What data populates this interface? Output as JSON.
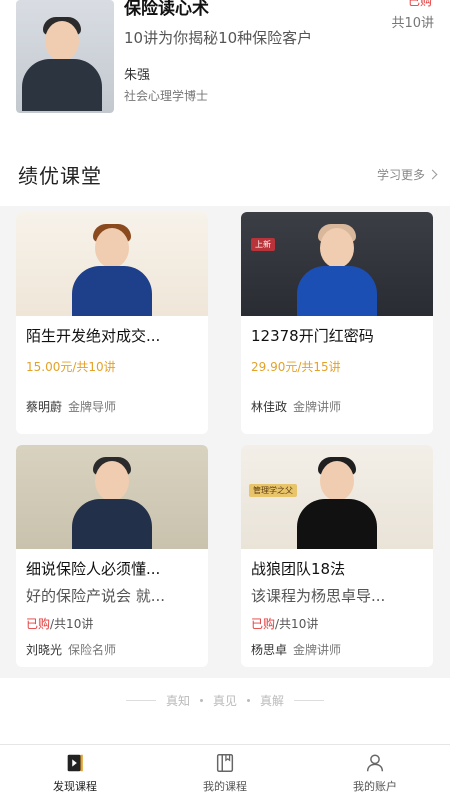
{
  "top_course": {
    "title": "保险读心术",
    "subtitle": "10讲为你揭秘10种保险客户",
    "author": "朱强",
    "role": "社会心理学博士",
    "badge": "已购",
    "count": "共10讲"
  },
  "section": {
    "title": "绩优课堂",
    "more": "学习更多"
  },
  "cards": [
    {
      "title": "陌生开发绝对成交...",
      "price": "15.00元/共10讲",
      "author": "蔡明蔚",
      "role": "金牌导师"
    },
    {
      "title": "12378开门红密码",
      "price": "29.90元/共15讲",
      "author": "林佳政",
      "role": "金牌讲师",
      "tag": "上新"
    },
    {
      "title": "细说保险人必须懂...",
      "desc": "好的保险产说会 就...",
      "bought": "已购",
      "count": "/共10讲",
      "author": "刘晓光",
      "role": "保险名师"
    },
    {
      "title": "战狼团队18法",
      "desc": "该课程为杨思卓导...",
      "bought": "已购",
      "count": "/共10讲",
      "author": "杨思卓",
      "role": "金牌讲师",
      "tag": "管理学之父"
    }
  ],
  "tagline": [
    "真知",
    "真见",
    "真解"
  ],
  "tabs": [
    {
      "label": "发现课程",
      "icon": "discover-icon"
    },
    {
      "label": "我的课程",
      "icon": "book-icon"
    },
    {
      "label": "我的账户",
      "icon": "user-icon"
    }
  ],
  "colors": {
    "price": "#e3a22a",
    "bought": "#e23c3c"
  }
}
